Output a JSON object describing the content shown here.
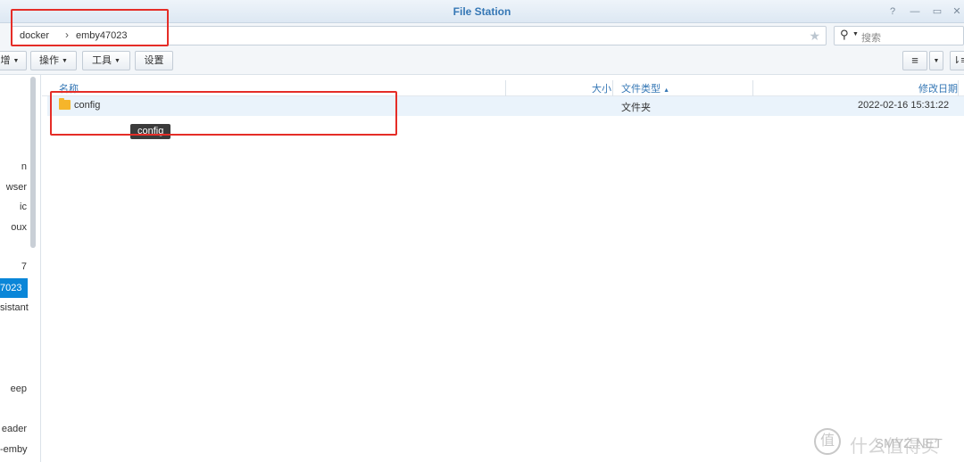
{
  "window": {
    "title": "File Station",
    "controls": [
      "?",
      "—",
      "▭",
      "✕"
    ]
  },
  "address": {
    "crumbs": [
      "docker",
      "emby47023"
    ],
    "search_placeholder": "搜索"
  },
  "toolbar": {
    "buttons": [
      {
        "label": "增",
        "dropdown": true
      },
      {
        "label": "操作",
        "dropdown": true
      },
      {
        "label": "工具",
        "dropdown": true
      },
      {
        "label": "设置",
        "dropdown": false
      }
    ],
    "view_icon": "list-icon",
    "sort_icon": "sort-icon"
  },
  "sidebar": {
    "items": [
      "n",
      "wser",
      "ic",
      "oux",
      "7",
      "7023",
      "sistant",
      "eep",
      "eader",
      "-emby"
    ],
    "active_index": 5
  },
  "columns": {
    "name": "名称",
    "size": "大小",
    "type": "文件类型",
    "modified": "修改日期"
  },
  "files": [
    {
      "name": "config",
      "size": "",
      "type": "文件夹",
      "modified": "2022-02-16 15:31:22"
    }
  ],
  "tooltip": "config",
  "watermark": {
    "logo_char": "值",
    "text": "什么值得买",
    "site": "SMYZ.NET"
  },
  "colors": {
    "accent": "#3577b5",
    "selected": "#0a86d8",
    "highlight_box": "#e52d27",
    "folder": "#f6b52a"
  }
}
